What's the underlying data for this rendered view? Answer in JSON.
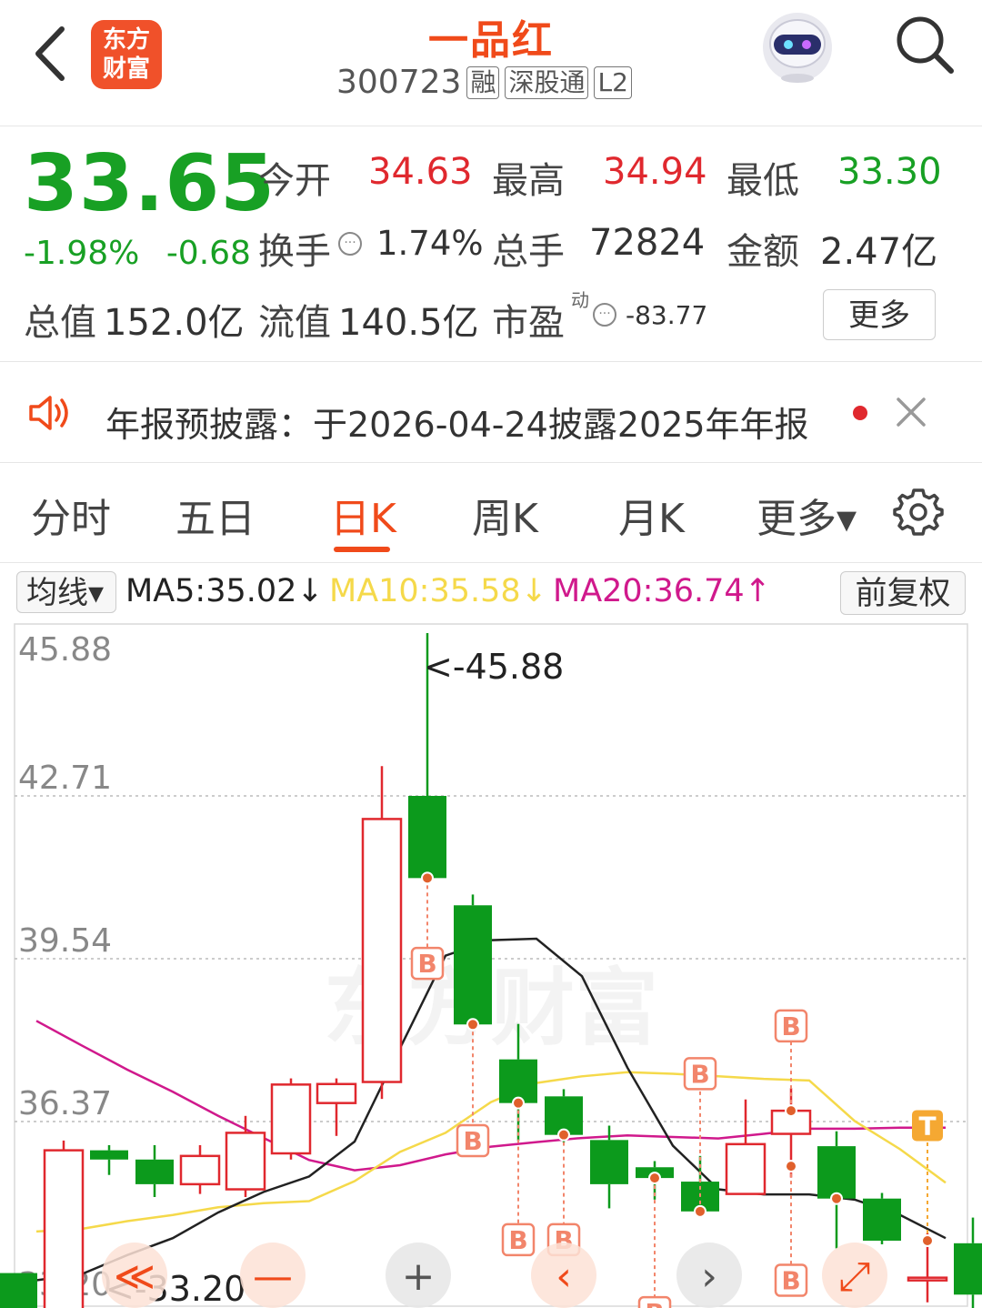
{
  "header": {
    "logo_line1": "东方",
    "logo_line2": "财富",
    "title": "一品红",
    "code": "300723",
    "tags": [
      "融",
      "深股通",
      "L2"
    ],
    "icons": {
      "back": "back-arrow-icon",
      "search": "search-icon",
      "assistant": "robot-assistant-icon"
    }
  },
  "quote": {
    "price": "33.65",
    "change_pct": "-1.98%",
    "change": "-0.68",
    "open_label": "今开",
    "open": "34.63",
    "high_label": "最高",
    "high": "34.94",
    "low_label": "最低",
    "low": "33.30",
    "turnover_label": "换手",
    "turnover": "1.74%",
    "volume_label": "总手",
    "volume": "72824",
    "amount_label": "金额",
    "amount": "2.47亿",
    "mktcap_label": "总值",
    "mktcap": "152.0亿",
    "float_label": "流值",
    "float_cap": "140.5亿",
    "pe_label": "市盈",
    "pe_sup": "动",
    "pe": "-83.77",
    "more_label": "更多",
    "colors": {
      "up": "#e0282e",
      "down": "#18a024"
    }
  },
  "notice": {
    "text": "年报预披露：于2026-04-24披露2025年年报",
    "icons": {
      "speaker": "speaker-icon",
      "close": "close-icon"
    }
  },
  "tabs": {
    "items": [
      "分时",
      "五日",
      "日K",
      "周K",
      "月K",
      "更多▾"
    ],
    "active": "日K",
    "settings_icon": "gear-icon"
  },
  "ma_bar": {
    "type_label": "均线▾",
    "ma5": "MA5:35.02↓",
    "ma10": "MA10:35.58↓",
    "ma20": "MA20:36.74↑",
    "adjust_label": "前复权",
    "colors": {
      "ma5": "#222222",
      "ma10": "#f5d94a",
      "ma20": "#d0198c"
    }
  },
  "chart_data": {
    "type": "candlestick",
    "y_ticks": [
      "45.88",
      "42.71",
      "39.54",
      "36.37",
      "33.20"
    ],
    "ylim": [
      33.2,
      45.88
    ],
    "max_label": "<-45.88",
    "min_label": "<-33.20",
    "watermark": "东方财富",
    "colors": {
      "up": "#e0282e",
      "down": "#0c9a1c",
      "signal": "#f2856b",
      "sell": "#f5a832"
    },
    "candles": [
      {
        "o": 33.42,
        "c": 32.62,
        "h": 33.42,
        "l": 32.62
      },
      {
        "o": 32.43,
        "c": 35.81,
        "h": 36.0,
        "l": 32.43
      },
      {
        "o": 35.81,
        "c": 35.63,
        "h": 35.91,
        "l": 35.33
      },
      {
        "o": 35.63,
        "c": 35.15,
        "h": 35.91,
        "l": 34.9
      },
      {
        "o": 35.15,
        "c": 35.7,
        "h": 35.91,
        "l": 34.96
      },
      {
        "o": 35.05,
        "c": 36.15,
        "h": 36.48,
        "l": 34.9
      },
      {
        "o": 35.75,
        "c": 37.09,
        "h": 37.21,
        "l": 35.63
      },
      {
        "o": 36.73,
        "c": 37.1,
        "h": 37.21,
        "l": 36.09
      },
      {
        "o": 37.14,
        "c": 42.26,
        "h": 43.29,
        "l": 36.81
      },
      {
        "o": 42.71,
        "c": 41.11,
        "h": 45.88,
        "l": 41.11
      },
      {
        "o": 40.58,
        "c": 38.26,
        "h": 40.79,
        "l": 38.18
      },
      {
        "o": 37.58,
        "c": 36.73,
        "h": 38.27,
        "l": 35.99
      },
      {
        "o": 36.86,
        "c": 36.11,
        "h": 37.0,
        "l": 35.96
      },
      {
        "o": 36.01,
        "c": 35.15,
        "h": 36.29,
        "l": 34.68
      },
      {
        "o": 35.48,
        "c": 35.27,
        "h": 35.6,
        "l": 34.85
      },
      {
        "o": 35.2,
        "c": 34.62,
        "h": 35.7,
        "l": 34.53
      },
      {
        "o": 34.96,
        "c": 35.93,
        "h": 36.8,
        "l": 34.96
      },
      {
        "o": 36.13,
        "c": 36.58,
        "h": 37.02,
        "l": 35.28
      },
      {
        "o": 35.89,
        "c": 34.87,
        "h": 36.18,
        "l": 33.9
      },
      {
        "o": 34.87,
        "c": 34.05,
        "h": 34.98,
        "l": 33.98
      },
      {
        "o": 33.3,
        "c": 33.33,
        "h": 34.2,
        "l": 32.85
      },
      {
        "o": 34.0,
        "c": 33.0,
        "h": 34.5,
        "l": 32.6
      }
    ],
    "ma5": [
      33.28,
      33.4,
      33.77,
      34.1,
      34.6,
      35.0,
      35.3,
      35.98,
      37.8,
      39.6,
      39.9,
      39.93,
      39.2,
      37.42,
      35.9,
      35.05,
      34.95,
      34.95,
      34.85,
      34.55,
      34.1
    ],
    "ma10": [
      34.23,
      34.28,
      34.43,
      34.55,
      34.7,
      34.78,
      34.82,
      35.21,
      35.78,
      36.15,
      36.75,
      37.12,
      37.25,
      37.33,
      37.3,
      37.25,
      37.2,
      37.17,
      36.38,
      35.83,
      35.18
    ],
    "ma20": [
      38.33,
      37.85,
      37.38,
      36.95,
      36.48,
      36.05,
      35.62,
      35.42,
      35.52,
      35.73,
      35.88,
      35.97,
      36.05,
      36.1,
      36.07,
      36.04,
      36.13,
      36.23,
      36.23,
      36.25,
      36.25
    ],
    "signals": [
      {
        "i": 9,
        "y": 41.11,
        "label": "B",
        "at": 39.75,
        "dir": "down"
      },
      {
        "i": 10,
        "y": 38.26,
        "label": "B",
        "at": 36.3,
        "dir": "down"
      },
      {
        "i": 11,
        "y": 36.73,
        "label": "B",
        "at": 34.37,
        "dir": "down"
      },
      {
        "i": 12,
        "y": 36.11,
        "label": "B",
        "at": 34.37,
        "dir": "down"
      },
      {
        "i": 14,
        "y": 35.27,
        "label": "B",
        "at": 32.95,
        "dir": "down"
      },
      {
        "i": 15,
        "y": 34.62,
        "label": "B",
        "at": 37.0,
        "dir": "up"
      },
      {
        "i": 17,
        "y": 36.58,
        "label": "B",
        "at": 37.93,
        "dir": "up"
      },
      {
        "i": 17,
        "y": 35.5,
        "label": "B",
        "at": 33.58,
        "dir": "down"
      },
      {
        "i": 18,
        "y": 34.87,
        "label": "",
        "at": 34.87,
        "dir": "none"
      },
      {
        "i": 20,
        "y": 34.05,
        "label": "T",
        "at": 35.99,
        "dir": "up",
        "kind": "sell"
      }
    ],
    "controls": [
      {
        "name": "scroll-left-fast-button",
        "glyph": "≪"
      },
      {
        "name": "zoom-out-button",
        "glyph": "—"
      },
      {
        "name": "zoom-in-button",
        "glyph": "+"
      },
      {
        "name": "prev-button",
        "glyph": "‹"
      },
      {
        "name": "next-button",
        "glyph": "›"
      },
      {
        "name": "fullscreen-button",
        "glyph": "⤢"
      }
    ]
  }
}
